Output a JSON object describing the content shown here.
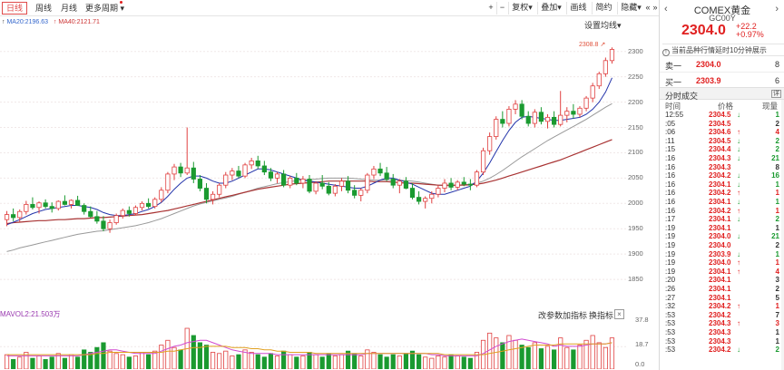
{
  "toolbar": {
    "periods": [
      {
        "label": "日线",
        "active": true
      },
      {
        "label": "周线",
        "active": false
      },
      {
        "label": "月线",
        "active": false
      },
      {
        "label": "更多周期",
        "active": false,
        "dropdown": true
      }
    ],
    "zoom_in": "+",
    "zoom_out": "−",
    "tools": [
      "复权",
      "叠加",
      "画线",
      "简约",
      "隐藏"
    ],
    "nav_left": "«",
    "nav_right": "»"
  },
  "indicators": {
    "ma20": "MA20:2196.63",
    "ma40": "MA40:2121.71",
    "setting": "设置均线",
    "latest_price_tag": "2308.8"
  },
  "volume": {
    "label": "MAVOL2:21.503万",
    "buttons": [
      "改参数",
      "加指标",
      "换指标"
    ],
    "close": "×",
    "axis_ticks": [
      "37.8",
      "18.7",
      "0.0"
    ]
  },
  "chart_data": {
    "type": "candlestick",
    "ylim": [
      1800,
      2330
    ],
    "y_ticks": [
      2300,
      2250,
      2200,
      2150,
      2100,
      2050,
      2000,
      1950,
      1900,
      1850
    ],
    "series": [
      {
        "name": "MA20",
        "color": "#3366cc"
      },
      {
        "name": "MA40",
        "color": "#cc3333"
      }
    ],
    "colors": {
      "up": "#e04040",
      "down": "#1a9a30",
      "ma_short": "#2233aa",
      "ma20": "#999999",
      "ma40": "#a83232"
    },
    "note_values": "approximate daily OHLC read from the chart, oldest first",
    "ohlc": [
      [
        1968,
        1985,
        1955,
        1978
      ],
      [
        1978,
        1990,
        1965,
        1972
      ],
      [
        1972,
        1988,
        1964,
        1984
      ],
      [
        1984,
        2005,
        1978,
        1998
      ],
      [
        1998,
        2012,
        1988,
        1992
      ],
      [
        1992,
        2004,
        1980,
        2001
      ],
      [
        2001,
        2008,
        1990,
        1994
      ],
      [
        1994,
        2002,
        1982,
        1990
      ],
      [
        1990,
        2006,
        1986,
        2004
      ],
      [
        2004,
        2016,
        1996,
        1998
      ],
      [
        1998,
        2008,
        1990,
        2006
      ],
      [
        2006,
        2015,
        1995,
        1996
      ],
      [
        1996,
        2000,
        1978,
        1984
      ],
      [
        1984,
        1994,
        1972,
        1974
      ],
      [
        1974,
        1985,
        1960,
        1965
      ],
      [
        1965,
        1975,
        1945,
        1950
      ],
      [
        1950,
        1968,
        1942,
        1962
      ],
      [
        1962,
        1980,
        1958,
        1976
      ],
      [
        1976,
        1990,
        1970,
        1986
      ],
      [
        1986,
        1994,
        1974,
        1980
      ],
      [
        1980,
        1996,
        1976,
        1992
      ],
      [
        1992,
        2004,
        1986,
        2000
      ],
      [
        2000,
        2010,
        1990,
        1994
      ],
      [
        1994,
        2012,
        1990,
        2008
      ],
      [
        2008,
        2032,
        2002,
        2026
      ],
      [
        2026,
        2062,
        2020,
        2058
      ],
      [
        2058,
        2078,
        2046,
        2072
      ],
      [
        2072,
        2080,
        2052,
        2060
      ],
      [
        2060,
        2150,
        2056,
        2070
      ],
      [
        2070,
        2082,
        2040,
        2048
      ],
      [
        2048,
        2056,
        2024,
        2030
      ],
      [
        2030,
        2040,
        2000,
        2008
      ],
      [
        2008,
        2024,
        1998,
        2018
      ],
      [
        2018,
        2040,
        2012,
        2036
      ],
      [
        2036,
        2062,
        2030,
        2056
      ],
      [
        2056,
        2070,
        2046,
        2064
      ],
      [
        2064,
        2074,
        2050,
        2054
      ],
      [
        2054,
        2080,
        2050,
        2076
      ],
      [
        2076,
        2090,
        2068,
        2084
      ],
      [
        2084,
        2094,
        2068,
        2074
      ],
      [
        2074,
        2084,
        2056,
        2062
      ],
      [
        2062,
        2070,
        2044,
        2050
      ],
      [
        2050,
        2062,
        2040,
        2058
      ],
      [
        2058,
        2066,
        2032,
        2036
      ],
      [
        2036,
        2054,
        2030,
        2050
      ],
      [
        2050,
        2060,
        2036,
        2040
      ],
      [
        2040,
        2054,
        2030,
        2048
      ],
      [
        2048,
        2056,
        2020,
        2024
      ],
      [
        2024,
        2044,
        2018,
        2040
      ],
      [
        2040,
        2056,
        2028,
        2034
      ],
      [
        2034,
        2042,
        2016,
        2020
      ],
      [
        2020,
        2038,
        2014,
        2034
      ],
      [
        2034,
        2050,
        2024,
        2044
      ],
      [
        2044,
        2054,
        2020,
        2026
      ],
      [
        2026,
        2036,
        2010,
        2016
      ],
      [
        2016,
        2030,
        2004,
        2026
      ],
      [
        2026,
        2060,
        2020,
        2056
      ],
      [
        2056,
        2074,
        2048,
        2068
      ],
      [
        2068,
        2080,
        2054,
        2060
      ],
      [
        2060,
        2072,
        2044,
        2048
      ],
      [
        2048,
        2058,
        2030,
        2036
      ],
      [
        2036,
        2048,
        2020,
        2044
      ],
      [
        2044,
        2052,
        2028,
        2030
      ],
      [
        2030,
        2040,
        2008,
        2012
      ],
      [
        2012,
        2024,
        1998,
        2004
      ],
      [
        2004,
        2014,
        1990,
        2010
      ],
      [
        2010,
        2024,
        2000,
        2018
      ],
      [
        2018,
        2036,
        2012,
        2030
      ],
      [
        2030,
        2048,
        2022,
        2040
      ],
      [
        2040,
        2050,
        2026,
        2032
      ],
      [
        2032,
        2046,
        2026,
        2042
      ],
      [
        2042,
        2052,
        2034,
        2038
      ],
      [
        2038,
        2048,
        2026,
        2036
      ],
      [
        2036,
        2066,
        2032,
        2062
      ],
      [
        2062,
        2110,
        2056,
        2104
      ],
      [
        2104,
        2140,
        2096,
        2132
      ],
      [
        2132,
        2172,
        2126,
        2166
      ],
      [
        2166,
        2182,
        2150,
        2158
      ],
      [
        2158,
        2192,
        2152,
        2186
      ],
      [
        2186,
        2204,
        2176,
        2196
      ],
      [
        2196,
        2204,
        2166,
        2172
      ],
      [
        2172,
        2182,
        2152,
        2158
      ],
      [
        2158,
        2186,
        2150,
        2180
      ],
      [
        2180,
        2190,
        2156,
        2162
      ],
      [
        2162,
        2176,
        2148,
        2170
      ],
      [
        2170,
        2182,
        2150,
        2156
      ],
      [
        2156,
        2222,
        2152,
        2174
      ],
      [
        2174,
        2190,
        2160,
        2182
      ],
      [
        2182,
        2196,
        2168,
        2176
      ],
      [
        2176,
        2192,
        2170,
        2188
      ],
      [
        2188,
        2212,
        2182,
        2208
      ],
      [
        2208,
        2238,
        2200,
        2232
      ],
      [
        2232,
        2260,
        2226,
        2256
      ],
      [
        2256,
        2288,
        2250,
        2282
      ],
      [
        2282,
        2308,
        2276,
        2304
      ]
    ],
    "ma_short": [
      1958,
      1963,
      1968,
      1974,
      1980,
      1984,
      1988,
      1990,
      1992,
      1994,
      1996,
      1996,
      1994,
      1992,
      1988,
      1982,
      1978,
      1976,
      1976,
      1978,
      1980,
      1984,
      1988,
      1994,
      2002,
      2014,
      2028,
      2040,
      2050,
      2054,
      2054,
      2050,
      2044,
      2040,
      2040,
      2044,
      2050,
      2056,
      2062,
      2068,
      2068,
      2066,
      2062,
      2058,
      2054,
      2050,
      2046,
      2044,
      2042,
      2040,
      2038,
      2036,
      2034,
      2032,
      2030,
      2030,
      2034,
      2040,
      2046,
      2050,
      2050,
      2046,
      2042,
      2038,
      2032,
      2026,
      2020,
      2018,
      2018,
      2022,
      2026,
      2030,
      2034,
      2044,
      2060,
      2080,
      2102,
      2124,
      2144,
      2160,
      2170,
      2172,
      2170,
      2168,
      2166,
      2164,
      2164,
      2166,
      2168,
      2170,
      2176,
      2186,
      2200,
      2220,
      2248
    ],
    "ma20_values": [
      1905,
      1908,
      1912,
      1915,
      1918,
      1921,
      1924,
      1927,
      1930,
      1933,
      1936,
      1939,
      1941,
      1943,
      1945,
      1946,
      1948,
      1950,
      1952,
      1954,
      1956,
      1959,
      1962,
      1966,
      1970,
      1975,
      1980,
      1985,
      1990,
      1995,
      1999,
      2002,
      2005,
      2008,
      2011,
      2014,
      2018,
      2022,
      2026,
      2030,
      2033,
      2036,
      2039,
      2041,
      2043,
      2045,
      2046,
      2047,
      2048,
      2049,
      2050,
      2050,
      2050,
      2050,
      2049,
      2048,
      2047,
      2046,
      2046,
      2046,
      2046,
      2046,
      2045,
      2044,
      2042,
      2040,
      2038,
      2036,
      2035,
      2035,
      2036,
      2037,
      2038,
      2040,
      2044,
      2050,
      2057,
      2065,
      2074,
      2083,
      2092,
      2100,
      2108,
      2116,
      2124,
      2131,
      2138,
      2145,
      2152,
      2159,
      2166,
      2174,
      2182,
      2190,
      2197
    ],
    "ma40_values": [
      1960,
      1962,
      1963,
      1964,
      1965,
      1966,
      1966,
      1967,
      1968,
      1968,
      1969,
      1970,
      1970,
      1971,
      1972,
      1972,
      1973,
      1974,
      1975,
      1976,
      1977,
      1978,
      1980,
      1982,
      1984,
      1986,
      1989,
      1992,
      1995,
      1998,
      2001,
      2004,
      2007,
      2010,
      2013,
      2016,
      2019,
      2022,
      2025,
      2028,
      2030,
      2032,
      2034,
      2036,
      2038,
      2039,
      2040,
      2041,
      2042,
      2043,
      2044,
      2044,
      2044,
      2044,
      2044,
      2044,
      2044,
      2043,
      2043,
      2043,
      2042,
      2041,
      2040,
      2040,
      2039,
      2038,
      2037,
      2036,
      2036,
      2036,
      2036,
      2036,
      2037,
      2038,
      2040,
      2043,
      2046,
      2050,
      2054,
      2058,
      2062,
      2066,
      2070,
      2074,
      2078,
      2082,
      2086,
      2091,
      2096,
      2101,
      2106,
      2111,
      2116,
      2121,
      2126
    ],
    "volume_ylim": [
      0,
      37.8
    ],
    "volume": [
      12,
      8,
      10,
      14,
      9,
      11,
      8,
      10,
      13,
      9,
      12,
      10,
      16,
      14,
      18,
      22,
      15,
      13,
      12,
      10,
      11,
      14,
      12,
      15,
      20,
      24,
      18,
      16,
      34,
      28,
      22,
      20,
      14,
      13,
      15,
      11,
      12,
      16,
      14,
      12,
      10,
      13,
      11,
      15,
      12,
      10,
      11,
      14,
      12,
      10,
      13,
      11,
      12,
      15,
      13,
      11,
      16,
      14,
      12,
      10,
      12,
      11,
      13,
      15,
      12,
      10,
      9,
      11,
      10,
      12,
      11,
      10,
      9,
      14,
      24,
      30,
      26,
      22,
      28,
      24,
      20,
      18,
      22,
      17,
      19,
      16,
      26,
      18,
      16,
      20,
      24,
      28,
      22,
      18,
      26
    ],
    "vol_ma1": [
      11,
      11,
      11,
      11,
      11,
      11,
      11,
      11,
      11,
      11,
      11,
      11,
      12,
      13,
      14,
      15,
      16,
      16,
      15,
      14,
      13,
      13,
      13,
      13,
      15,
      17,
      19,
      20,
      22,
      23,
      24,
      24,
      22,
      20,
      18,
      16,
      15,
      14,
      13,
      13,
      13,
      13,
      12,
      12,
      12,
      12,
      12,
      12,
      12,
      12,
      12,
      12,
      12,
      12,
      12,
      12,
      13,
      13,
      13,
      13,
      13,
      13,
      13,
      13,
      13,
      13,
      12,
      12,
      11,
      11,
      11,
      11,
      11,
      11,
      13,
      16,
      19,
      21,
      23,
      24,
      25,
      24,
      23,
      22,
      21,
      19,
      20,
      19,
      19,
      19,
      20,
      21,
      21,
      21,
      22
    ],
    "vol_ma2": [
      12,
      12,
      12,
      12,
      12,
      12,
      12,
      12,
      12,
      12,
      12,
      12,
      12,
      12,
      13,
      13,
      14,
      14,
      14,
      14,
      14,
      14,
      14,
      14,
      14,
      15,
      15,
      16,
      17,
      18,
      18,
      19,
      19,
      19,
      19,
      18,
      18,
      18,
      17,
      17,
      16,
      16,
      15,
      15,
      14,
      14,
      14,
      14,
      13,
      13,
      13,
      13,
      13,
      13,
      13,
      13,
      13,
      13,
      13,
      13,
      13,
      13,
      13,
      13,
      13,
      13,
      13,
      13,
      12,
      12,
      12,
      12,
      12,
      12,
      12,
      13,
      14,
      15,
      16,
      17,
      18,
      19,
      20,
      20,
      20,
      20,
      21,
      21,
      21,
      21,
      21,
      21,
      21,
      21,
      22
    ]
  },
  "quote": {
    "name": "COMEX黄金",
    "code": "GC00Y",
    "nav_prev": "‹",
    "nav_next": "›",
    "price": "2304.0",
    "change": "+22.2",
    "change_pct": "+0.97%",
    "notice": "当前品种行情延时10分钟展示",
    "ask": {
      "label": "卖一",
      "price": "2304.0",
      "qty": "8"
    },
    "bid": {
      "label": "买一",
      "price": "2303.9",
      "qty": "6"
    },
    "trades_title": "分时成交",
    "expand": "详",
    "trades_header": {
      "time": "时间",
      "price": "价格",
      "vol": "现量"
    },
    "trades": [
      {
        "time": "12:55",
        "price": "2304.5",
        "dir": "↓",
        "vol": "1"
      },
      {
        "time": ":05",
        "price": "2304.5",
        "dir": "",
        "vol": "2"
      },
      {
        "time": ":06",
        "price": "2304.6",
        "dir": "↑",
        "vol": "4"
      },
      {
        "time": ":11",
        "price": "2304.5",
        "dir": "↓",
        "vol": "2"
      },
      {
        "time": ":15",
        "price": "2304.4",
        "dir": "↓",
        "vol": "2"
      },
      {
        "time": ":16",
        "price": "2304.3",
        "dir": "↓",
        "vol": "21"
      },
      {
        "time": ":16",
        "price": "2304.3",
        "dir": "",
        "vol": "8"
      },
      {
        "time": ":16",
        "price": "2304.2",
        "dir": "↓",
        "vol": "16"
      },
      {
        "time": ":16",
        "price": "2304.1",
        "dir": "↓",
        "vol": "1"
      },
      {
        "time": ":16",
        "price": "2304.2",
        "dir": "↑",
        "vol": "1"
      },
      {
        "time": ":16",
        "price": "2304.1",
        "dir": "↓",
        "vol": "1"
      },
      {
        "time": ":16",
        "price": "2304.2",
        "dir": "↑",
        "vol": "1"
      },
      {
        "time": ":17",
        "price": "2304.1",
        "dir": "↓",
        "vol": "2"
      },
      {
        "time": ":19",
        "price": "2304.1",
        "dir": "",
        "vol": "1"
      },
      {
        "time": ":19",
        "price": "2304.0",
        "dir": "↓",
        "vol": "21"
      },
      {
        "time": ":19",
        "price": "2304.0",
        "dir": "",
        "vol": "2"
      },
      {
        "time": ":19",
        "price": "2303.9",
        "dir": "↓",
        "vol": "1"
      },
      {
        "time": ":19",
        "price": "2304.0",
        "dir": "↑",
        "vol": "1"
      },
      {
        "time": ":19",
        "price": "2304.1",
        "dir": "↑",
        "vol": "4"
      },
      {
        "time": ":20",
        "price": "2304.1",
        "dir": "",
        "vol": "3"
      },
      {
        "time": ":26",
        "price": "2304.1",
        "dir": "",
        "vol": "2"
      },
      {
        "time": ":27",
        "price": "2304.1",
        "dir": "",
        "vol": "5"
      },
      {
        "time": ":32",
        "price": "2304.2",
        "dir": "↑",
        "vol": "1"
      },
      {
        "time": ":53",
        "price": "2304.2",
        "dir": "",
        "vol": "7"
      },
      {
        "time": ":53",
        "price": "2304.3",
        "dir": "↑",
        "vol": "3"
      },
      {
        "time": ":53",
        "price": "2304.3",
        "dir": "",
        "vol": "1"
      },
      {
        "time": ":53",
        "price": "2304.3",
        "dir": "",
        "vol": "1"
      },
      {
        "time": ":53",
        "price": "2304.2",
        "dir": "↓",
        "vol": "2"
      }
    ]
  }
}
